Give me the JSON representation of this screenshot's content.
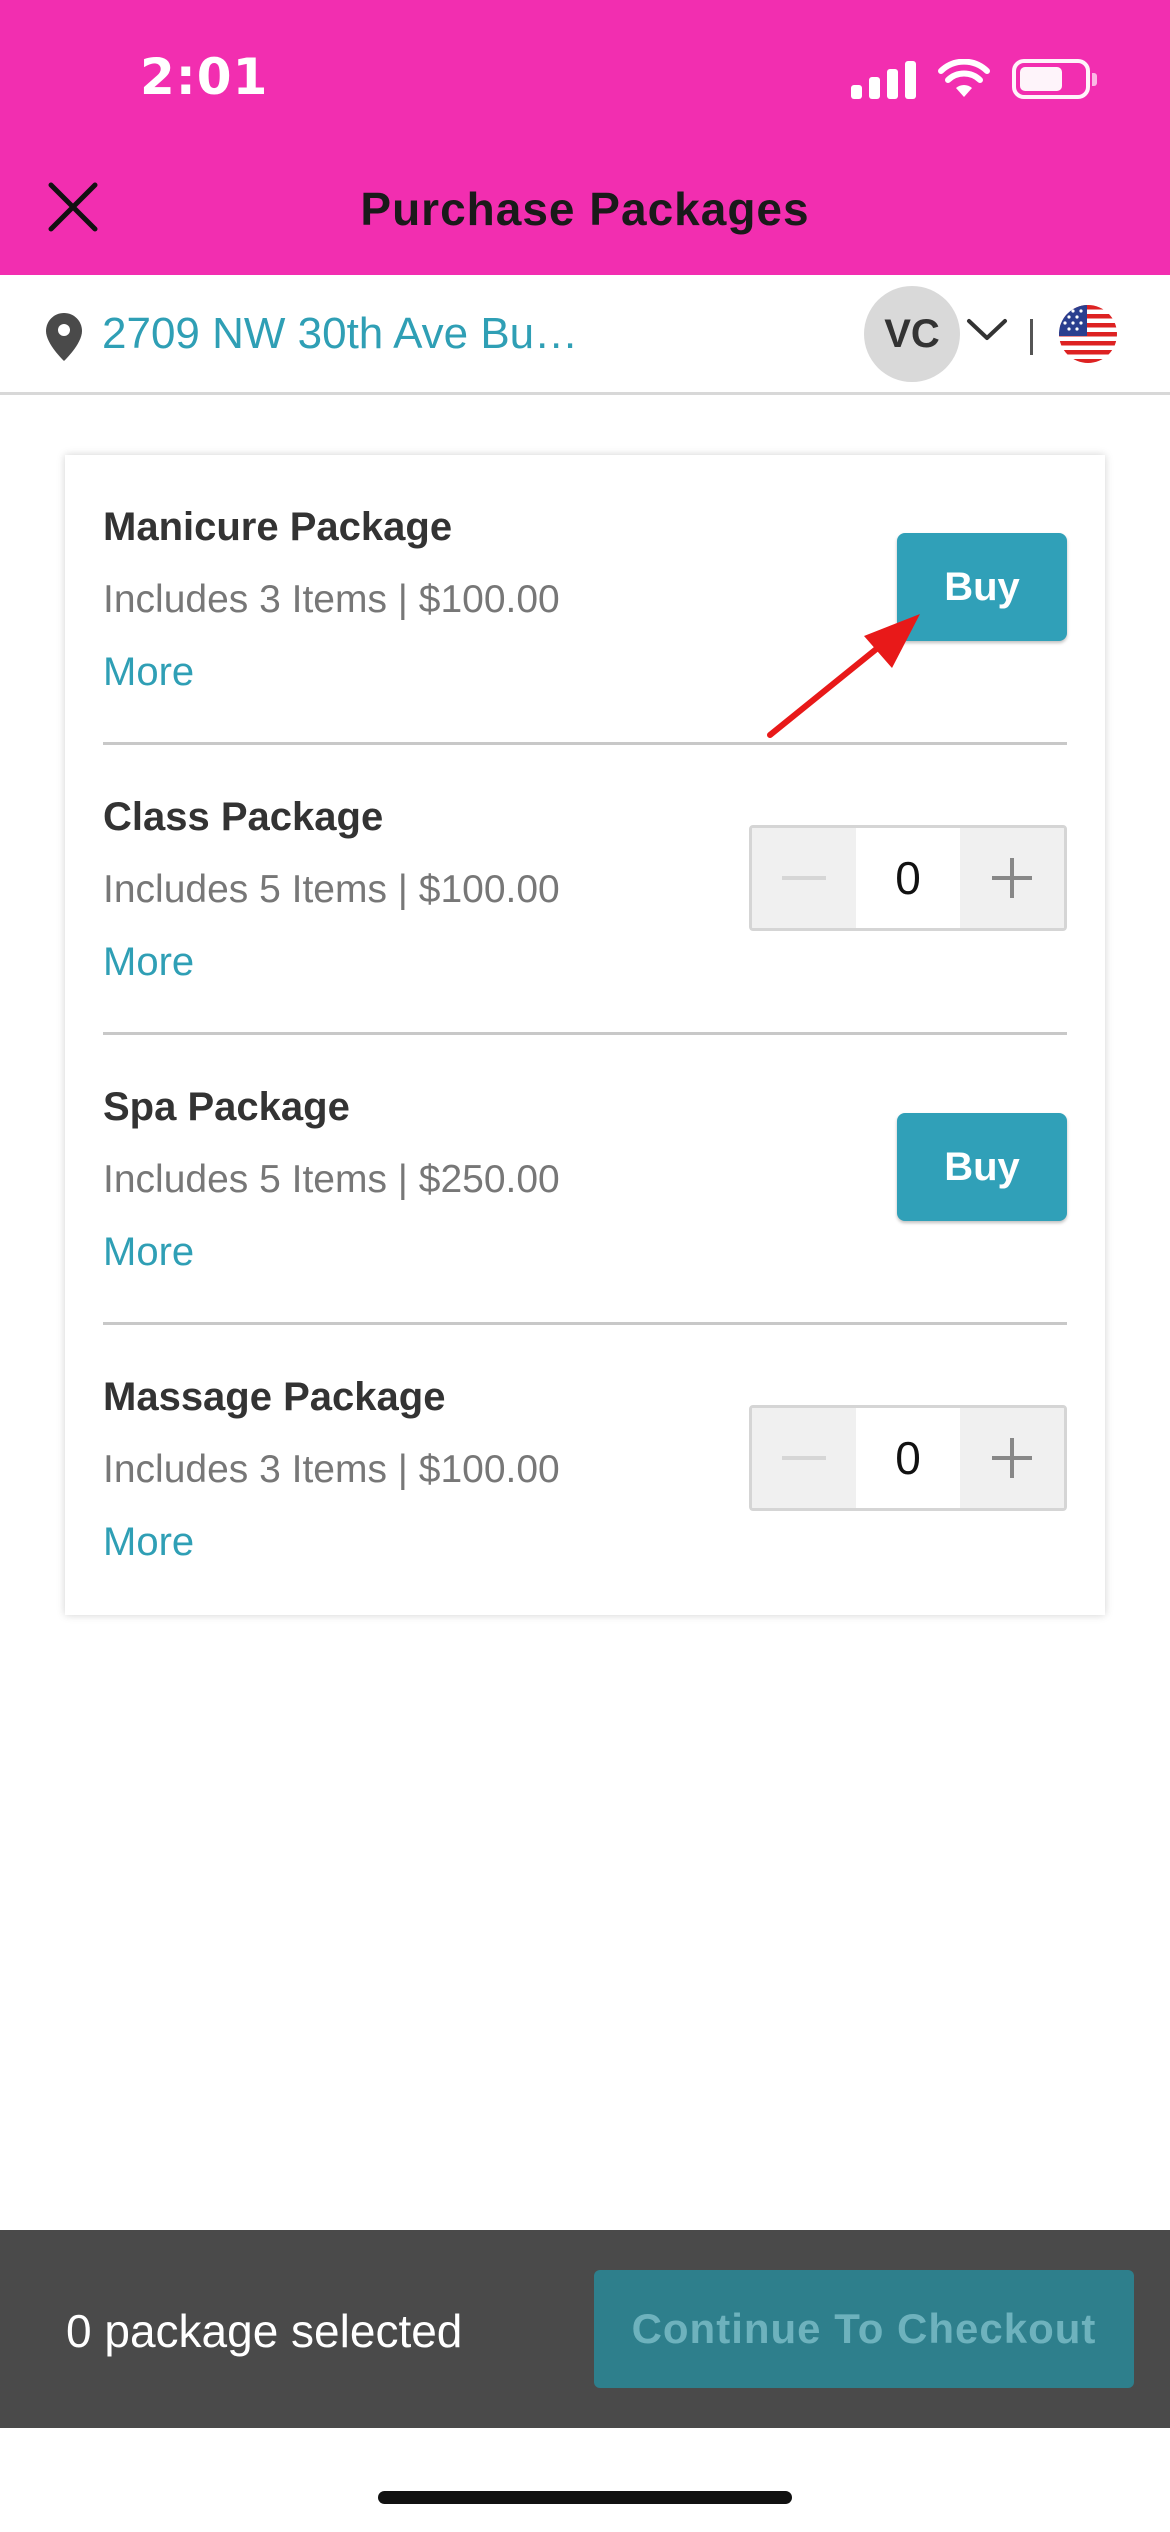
{
  "status_bar": {
    "time": "2:01"
  },
  "header": {
    "title": "Purchase Packages",
    "close_icon": "close-icon"
  },
  "location": {
    "address": "2709 NW 30th Ave Bu…",
    "avatar_initials": "VC",
    "country_flag": "us-flag-icon"
  },
  "packages": [
    {
      "name": "Manicure Package",
      "description": "Includes 3 Items | $100.00",
      "more_label": "More",
      "control": "buy",
      "buy_label": "Buy"
    },
    {
      "name": "Class Package",
      "description": "Includes 5 Items | $100.00",
      "more_label": "More",
      "control": "stepper",
      "quantity": "0"
    },
    {
      "name": "Spa Package",
      "description": "Includes 5 Items | $250.00",
      "more_label": "More",
      "control": "buy",
      "buy_label": "Buy"
    },
    {
      "name": "Massage Package",
      "description": "Includes 3 Items | $100.00",
      "more_label": "More",
      "control": "stepper",
      "quantity": "0"
    }
  ],
  "footer": {
    "selected_text": "0 package selected",
    "checkout_label": "Continue To Checkout"
  },
  "colors": {
    "brand_pink": "#f22eb0",
    "accent_teal": "#30a0b8",
    "footer_bg": "#4a4a4a",
    "annotation_arrow": "#e81919"
  }
}
